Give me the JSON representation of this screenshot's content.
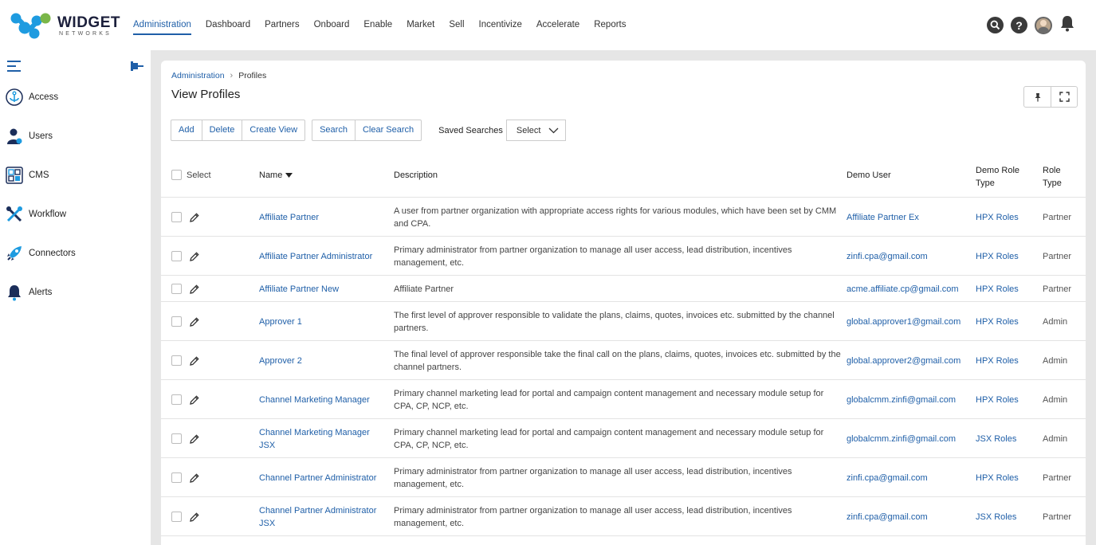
{
  "app": {
    "logo_text": "WIDGET",
    "logo_sub": "NETWORKS",
    "nav": [
      {
        "label": "Administration",
        "active": true
      },
      {
        "label": "Dashboard"
      },
      {
        "label": "Partners"
      },
      {
        "label": "Onboard"
      },
      {
        "label": "Enable"
      },
      {
        "label": "Market"
      },
      {
        "label": "Sell"
      },
      {
        "label": "Incentivize"
      },
      {
        "label": "Accelerate"
      },
      {
        "label": "Reports"
      }
    ],
    "icons": {
      "search": "search-icon",
      "help": "help-icon",
      "avatar": "avatar",
      "bell": "bell-icon"
    },
    "colors": {
      "accent": "#1f5fa8",
      "logo_blue": "#1e9be0",
      "logo_green": "#7ab648"
    }
  },
  "sidebar": {
    "items": [
      {
        "label": "Access",
        "icon": "anchor-icon"
      },
      {
        "label": "Users",
        "icon": "user-icon"
      },
      {
        "label": "CMS",
        "icon": "cms-icon"
      },
      {
        "label": "Workflow",
        "icon": "tools-icon"
      },
      {
        "label": "Connectors",
        "icon": "rocket-icon"
      },
      {
        "label": "Alerts",
        "icon": "bell-icon"
      }
    ]
  },
  "page": {
    "breadcrumb": [
      "Administration",
      "Profiles"
    ],
    "title": "View Profiles",
    "toolbar": {
      "group1": [
        "Add",
        "Delete",
        "Create View"
      ],
      "group2": [
        "Search",
        "Clear Search"
      ],
      "saved_searches_label": "Saved Searches",
      "saved_searches_value": "Select"
    }
  },
  "table": {
    "headers": {
      "select": "Select",
      "name": "Name",
      "description": "Description",
      "demo_user": "Demo User",
      "demo_role_type": "Demo Role Type",
      "role_type": "Role Type"
    },
    "rows": [
      {
        "name": "Affiliate Partner",
        "description": "A user from partner organization with appropriate access rights for various modules, which have been set by CMM and CPA.",
        "demo_user": "Affiliate Partner Ex",
        "demo_role_type": "HPX Roles",
        "role_type": "Partner"
      },
      {
        "name": "Affiliate Partner Administrator",
        "description": "Primary administrator from partner organization to manage all user access, lead distribution, incentives management, etc.",
        "demo_user": "zinfi.cpa@gmail.com",
        "demo_role_type": "HPX Roles",
        "role_type": "Partner"
      },
      {
        "name": "Affiliate Partner New",
        "description": "Affiliate Partner",
        "demo_user": "acme.affiliate.cp@gmail.com",
        "demo_role_type": "HPX Roles",
        "role_type": "Partner"
      },
      {
        "name": "Approver 1",
        "description": "The first level of approver responsible to validate the plans, claims, quotes, invoices etc. submitted by the channel partners.",
        "demo_user": "global.approver1@gmail.com",
        "demo_role_type": "HPX Roles",
        "role_type": "Admin"
      },
      {
        "name": "Approver 2",
        "description": "The final level of approver responsible take the final call on the plans, claims, quotes, invoices etc. submitted by the channel partners.",
        "demo_user": "global.approver2@gmail.com",
        "demo_role_type": "HPX Roles",
        "role_type": "Admin"
      },
      {
        "name": "Channel Marketing Manager",
        "description": "Primary channel marketing lead for portal and campaign content management and necessary module setup for CPA, CP, NCP, etc.",
        "demo_user": "globalcmm.zinfi@gmail.com",
        "demo_role_type": "HPX Roles",
        "role_type": "Admin"
      },
      {
        "name": "Channel Marketing Manager JSX",
        "description": "Primary channel marketing lead for portal and campaign content management and necessary module setup for CPA, CP, NCP, etc.",
        "demo_user": "globalcmm.zinfi@gmail.com",
        "demo_role_type": "JSX Roles",
        "role_type": "Admin"
      },
      {
        "name": "Channel Partner Administrator",
        "description": "Primary administrator from partner organization to manage all user access, lead distribution, incentives management, etc.",
        "demo_user": "zinfi.cpa@gmail.com",
        "demo_role_type": "HPX Roles",
        "role_type": "Partner"
      },
      {
        "name": "Channel Partner Administrator JSX",
        "description": "Primary administrator from partner organization to manage all user access, lead distribution, incentives management, etc.",
        "demo_user": "zinfi.cpa@gmail.com",
        "demo_role_type": "JSX Roles",
        "role_type": "Partner"
      }
    ]
  }
}
